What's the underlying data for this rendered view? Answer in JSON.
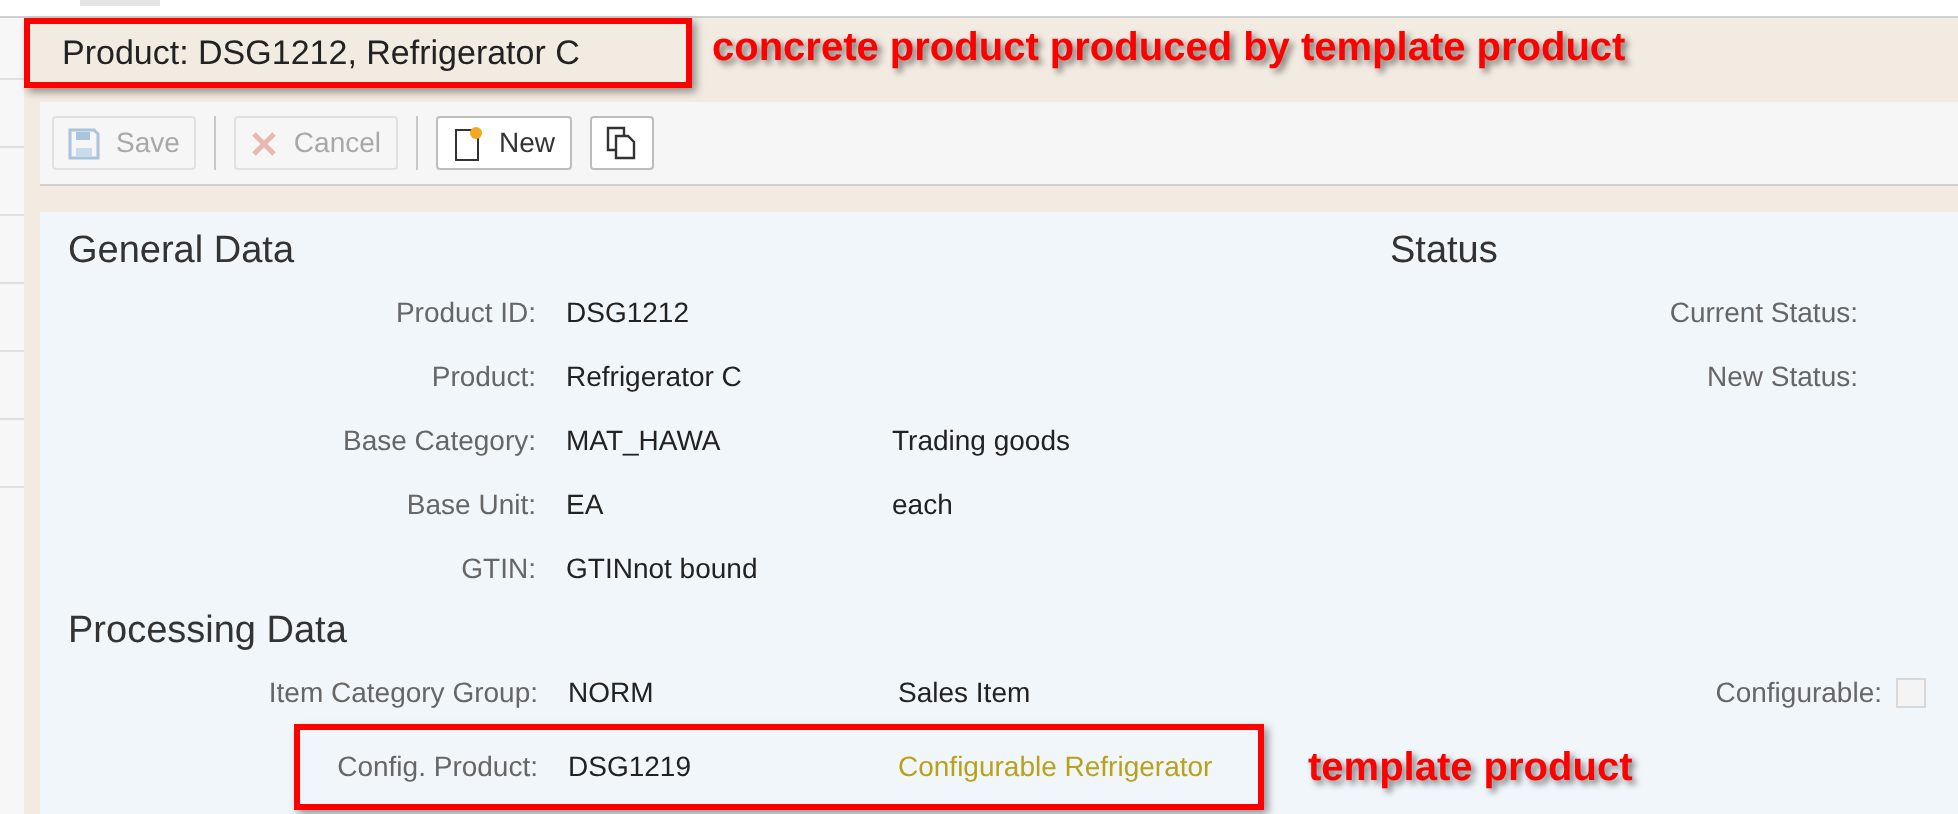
{
  "header": {
    "title": "Product: DSG1212, Refrigerator C",
    "boxed": true,
    "annotation": "concrete product produced by template product"
  },
  "toolbar": [
    {
      "kind": "save",
      "label": "Save",
      "disabled": true
    },
    {
      "kind": "cancel",
      "label": "Cancel",
      "disabled": true
    },
    {
      "kind": "new",
      "label": "New",
      "disabled": false
    },
    {
      "kind": "copy",
      "disabled": false
    }
  ],
  "general_data": {
    "title": "General Data",
    "fields": [
      {
        "label": "Product ID:",
        "value": "DSG1212"
      },
      {
        "label": "Product:",
        "value": "Refrigerator C"
      },
      {
        "label": "Base Category:",
        "value": "MAT_HAWA",
        "description": "Trading goods"
      },
      {
        "label": "Base Unit:",
        "value": "EA",
        "description": "each"
      },
      {
        "label": "GTIN:",
        "value": "GTINnot bound"
      }
    ]
  },
  "status": {
    "title": "Status",
    "fields": [
      {
        "label": "Current Status:"
      },
      {
        "label": "New Status:"
      }
    ]
  },
  "processing_data": {
    "title": "Processing Data",
    "fields": [
      {
        "label": "Item Category Group:",
        "value": "NORM",
        "description": "Sales Item",
        "description_highlighted": false,
        "boxed": false
      },
      {
        "label": "Config. Product:",
        "value": "DSG1219",
        "description": "Configurable Refrigerator",
        "description_highlighted": true,
        "boxed": true,
        "annotation": "template product"
      }
    ],
    "configurable": {
      "label": "Configurable:",
      "checked": false
    }
  }
}
